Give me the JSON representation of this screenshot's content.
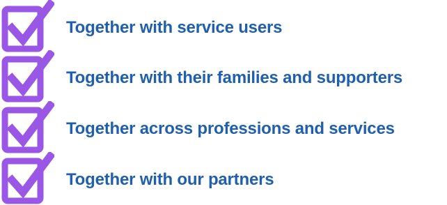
{
  "colors": {
    "check_purple": "#9a57e6",
    "text_blue": "#1f5fae"
  },
  "items": [
    {
      "icon": "checkbox-checked-icon",
      "label": "Together with service users"
    },
    {
      "icon": "checkbox-checked-icon",
      "label": "Together with their families and supporters"
    },
    {
      "icon": "checkbox-checked-icon",
      "label": "Together across professions and services"
    },
    {
      "icon": "checkbox-checked-icon",
      "label": "Together with our partners"
    }
  ]
}
